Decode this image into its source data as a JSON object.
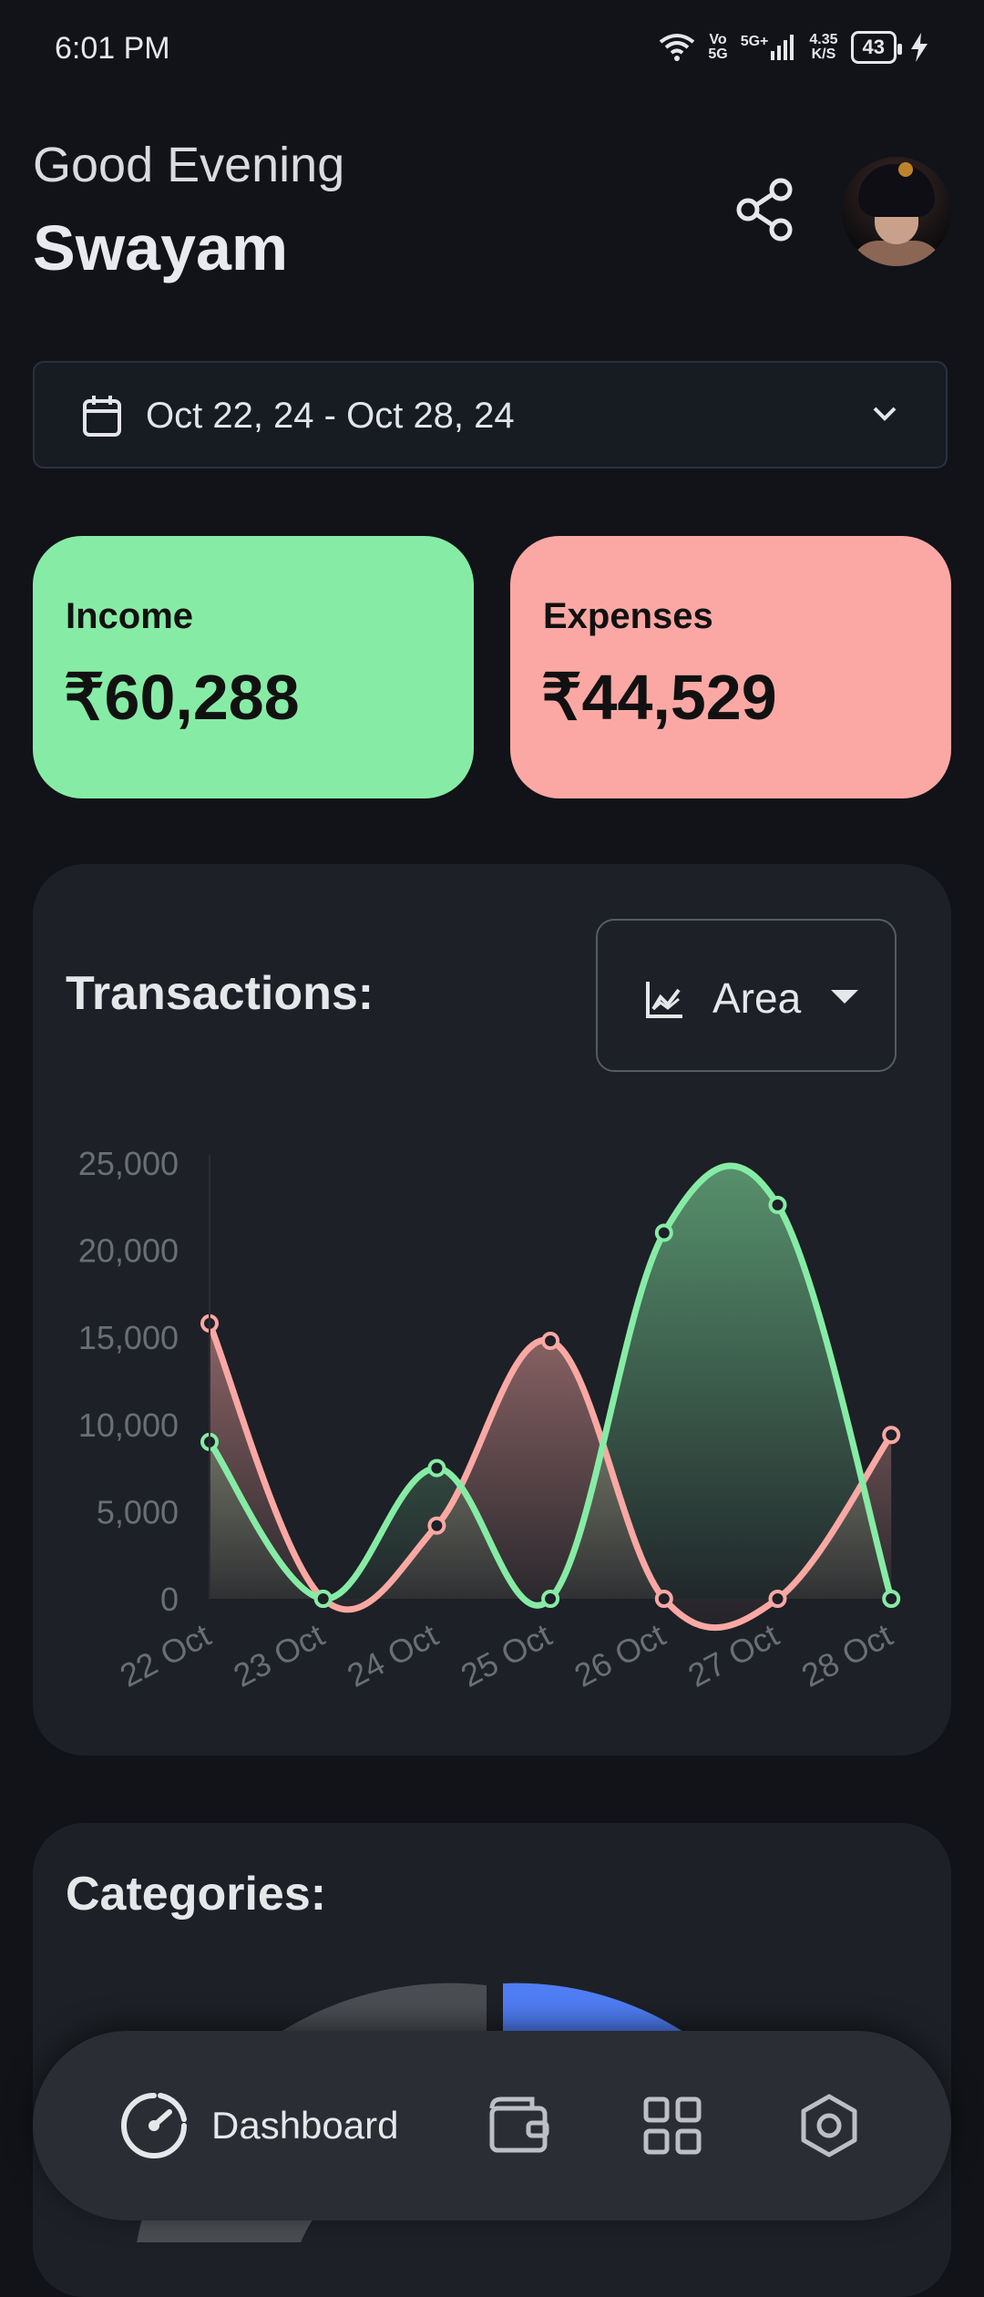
{
  "status_bar": {
    "time": "6:01 PM",
    "network_top": "Vo",
    "network_bottom": "5G",
    "signal": "5G+",
    "speed_value": "4.35",
    "speed_unit": "K/S",
    "battery": "43"
  },
  "header": {
    "greeting": "Good Evening",
    "user_name": "Swayam",
    "share_icon": "share-icon",
    "avatar": "avatar"
  },
  "date_filter": {
    "icon": "calendar-icon",
    "label": "Oct 22, 24 - Oct 28, 24",
    "dropdown_icon": "chevron-down-icon"
  },
  "summary": {
    "income_label": "Income",
    "income_value": "₹60,288",
    "income_color": "#86eca5",
    "expenses_label": "Expenses",
    "expenses_value": "₹44,529",
    "expenses_color": "#fba8a4"
  },
  "transactions": {
    "title": "Transactions:",
    "chart_type_label": "Area",
    "chart_type_icon": "area-chart-icon"
  },
  "chart_data": {
    "type": "area",
    "categories": [
      "22 Oct",
      "23 Oct",
      "24 Oct",
      "25 Oct",
      "26 Oct",
      "27 Oct",
      "28 Oct"
    ],
    "y_ticks": [
      "0",
      "5,000",
      "10,000",
      "15,000",
      "20,000",
      "25,000"
    ],
    "ylim": [
      0,
      25000
    ],
    "grid": false,
    "legend": "none",
    "series": [
      {
        "key": "expenses",
        "values": [
          15800,
          0,
          4200,
          14800,
          0,
          0,
          9400
        ],
        "color": "#fba8a4"
      },
      {
        "key": "income",
        "values": [
          9000,
          0,
          7500,
          0,
          21000,
          22600,
          0
        ],
        "color": "#86eca5"
      }
    ]
  },
  "categories": {
    "title": "Categories:",
    "accent_color": "#4f7df3"
  },
  "bottom_nav": {
    "dashboard_label": "Dashboard",
    "dashboard_icon": "speedometer-icon",
    "wallet_icon": "wallet-icon",
    "grid_icon": "grid-icon",
    "settings_icon": "hexagon-settings-icon"
  }
}
